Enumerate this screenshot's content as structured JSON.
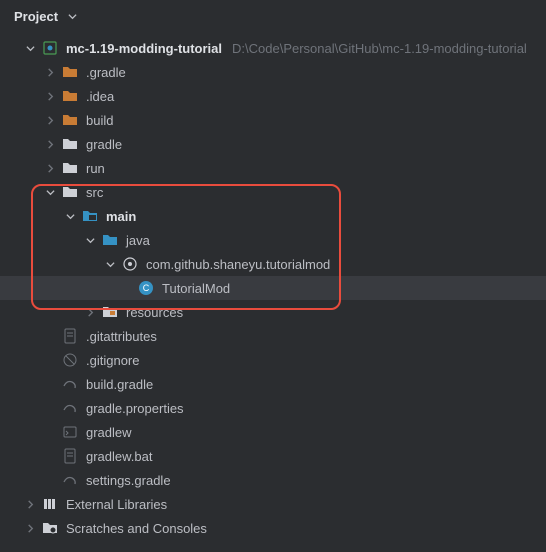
{
  "header": {
    "title": "Project"
  },
  "project": {
    "name": "mc-1.19-modding-tutorial",
    "path": "D:\\Code\\Personal\\GitHub\\mc-1.19-modding-tutorial"
  },
  "folders": {
    "gradle_dot": ".gradle",
    "idea_dot": ".idea",
    "build": "build",
    "gradle": "gradle",
    "run": "run",
    "src": "src",
    "main": "main",
    "java": "java",
    "package": "com.github.shaneyu.tutorialmod",
    "class": "TutorialMod",
    "resources": "resources"
  },
  "files": {
    "gitattributes": ".gitattributes",
    "gitignore": ".gitignore",
    "build_gradle": "build.gradle",
    "gradle_properties": "gradle.properties",
    "gradlew": "gradlew",
    "gradlew_bat": "gradlew.bat",
    "settings_gradle": "settings.gradle"
  },
  "bottom": {
    "external": "External Libraries",
    "scratches": "Scratches and Consoles"
  }
}
